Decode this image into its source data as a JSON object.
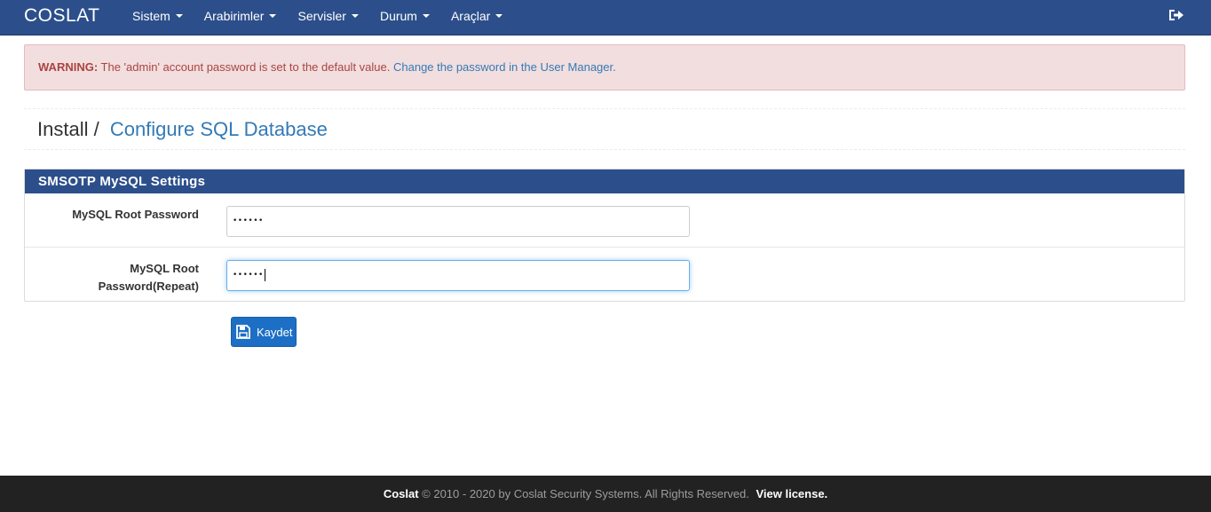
{
  "navbar": {
    "brand": "COSLAT",
    "menu": [
      {
        "label": "Sistem"
      },
      {
        "label": "Arabirimler"
      },
      {
        "label": "Servisler"
      },
      {
        "label": "Durum"
      },
      {
        "label": "Araçlar"
      }
    ],
    "logout_icon": "sign-out-icon"
  },
  "alert": {
    "prefix": "WARNING:",
    "message": " The 'admin' account password is set to the default value. ",
    "link": "Change the password in the User Manager."
  },
  "breadcrumb": {
    "parent": "Install /",
    "current": "Configure SQL Database"
  },
  "panel": {
    "title": "SMSOTP MySQL Settings",
    "fields": [
      {
        "label": "MySQL Root Password",
        "value": "••••••"
      },
      {
        "label_line1": "MySQL Root",
        "label_line2": "Password(Repeat)",
        "value": "••••••"
      }
    ]
  },
  "save_button": {
    "label": "Kaydet",
    "icon": "save-icon"
  },
  "footer": {
    "brand": "Coslat",
    "text": " © 2010 - 2020 by Coslat Security Systems. All Rights Reserved. ",
    "link": "View license."
  },
  "colors": {
    "navbar": "#2c4f8b",
    "alert_bg": "#f2dede",
    "alert_text": "#a94442",
    "link": "#337ab7",
    "button": "#1c6fc4",
    "footer": "#222222"
  }
}
